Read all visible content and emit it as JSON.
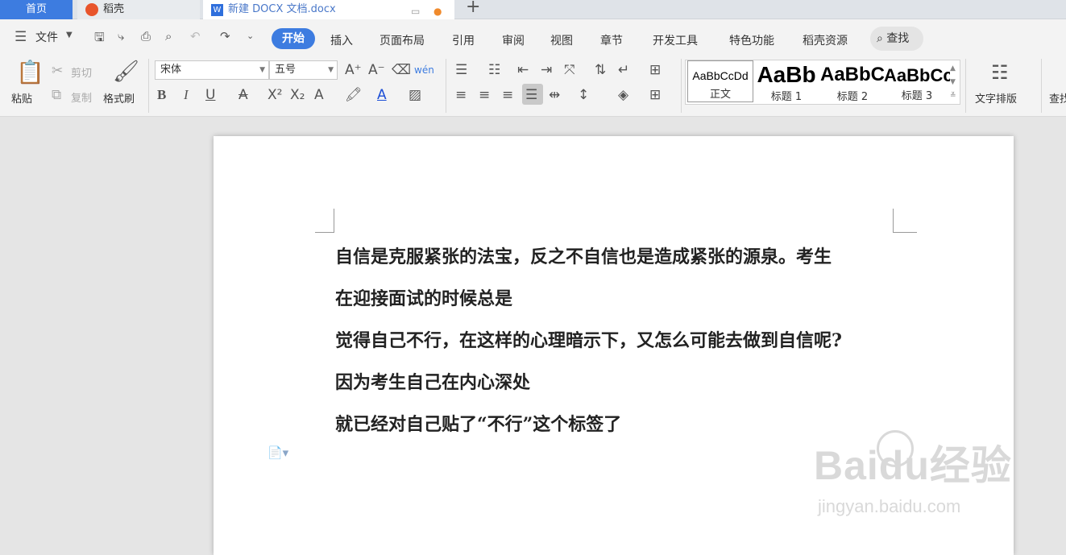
{
  "tabs": {
    "home": "首页",
    "daoke": "稻壳",
    "doc": "新建 DOCX 文档.docx",
    "new_tab": "+"
  },
  "menu": {
    "file": "文件",
    "items": [
      "开始",
      "插入",
      "页面布局",
      "引用",
      "审阅",
      "视图",
      "章节",
      "开发工具",
      "特色功能",
      "稻壳资源"
    ],
    "search": "查找"
  },
  "ribbon": {
    "paste": "粘贴",
    "cut": "剪切",
    "copy": "复制",
    "format_painter": "格式刷",
    "font_name": "宋体",
    "font_size": "五号",
    "styles": [
      {
        "preview": "AaBbCcDd",
        "label": "正文"
      },
      {
        "preview": "AaBb",
        "label": "标题 1"
      },
      {
        "preview": "AaBbC",
        "label": "标题 2"
      },
      {
        "preview": "AaBbCc",
        "label": "标题 3"
      }
    ],
    "text_layout": "文字排版",
    "find": "查找"
  },
  "document": {
    "paragraphs": [
      "自信是克服紧张的法宝，反之不自信也是造成紧张的源泉。考生",
      "在迎接面试的时候总是",
      "觉得自己不行，在这样的心理暗示下，又怎么可能去做到自信呢?",
      "因为考生自己在内心深处",
      "就已经对自己贴了“不行”这个标签了"
    ]
  },
  "watermark": {
    "brand": "Baidu经验",
    "url": "jingyan.baidu.com"
  },
  "colors": {
    "accent": "#3d7ce0",
    "tab_home": "#3d7ce0"
  }
}
